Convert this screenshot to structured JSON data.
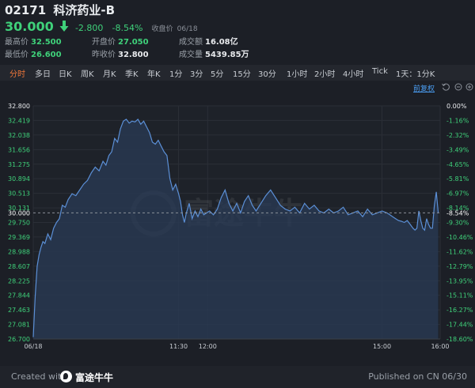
{
  "stock": {
    "code": "02171",
    "name": "科济药业-B",
    "price": "30.000",
    "change": "-2.800",
    "change_pct": "-8.54%",
    "closed_label": "收盘价",
    "date": "06/18"
  },
  "stats": {
    "high_label": "最高价",
    "high": "32.500",
    "low_label": "最低价",
    "low": "26.600",
    "open_label": "开盘价",
    "open": "27.050",
    "prev_label": "昨收价",
    "prev": "32.800",
    "turnover_label": "成交额",
    "turnover": "16.08亿",
    "volume_label": "成交量",
    "volume": "5439.85万"
  },
  "tabs": [
    "分时",
    "多日",
    "日K",
    "周K",
    "月K",
    "季K",
    "年K",
    "1分",
    "3分",
    "5分",
    "15分",
    "30分",
    "1小时",
    "2小时",
    "4小时",
    "Tick",
    "1天：1分K"
  ],
  "active_tab": 0,
  "adjust_label": "前复权",
  "watermark": "富途牛牛",
  "footer": {
    "created_with": "Created with",
    "brand": "富途牛牛",
    "published": "Published on CN 06/30"
  },
  "colors": {
    "background": "#1c1f26",
    "line": "#5b8fd6",
    "area": "#2a3b55",
    "down": "#3fd17a",
    "active_tab": "#f0773a",
    "link": "#4a9cf0"
  },
  "chart_data": {
    "type": "area",
    "left_ticks": [
      "32.800",
      "32.419",
      "32.038",
      "31.656",
      "31.275",
      "30.894",
      "30.513",
      "30.131",
      "30.000",
      "29.750",
      "29.369",
      "28.988",
      "28.607",
      "28.225",
      "27.844",
      "27.463",
      "27.081",
      "26.700"
    ],
    "right_ticks": [
      "0.00%",
      "-1.16%",
      "-2.32%",
      "-3.49%",
      "-4.65%",
      "-5.81%",
      "-6.97%",
      "-8.14%",
      "-8.54%",
      "-9.30%",
      "-10.46%",
      "-11.62%",
      "-12.79%",
      "-13.95%",
      "-15.11%",
      "-16.27%",
      "-17.44%",
      "-18.60%"
    ],
    "x_labels": [
      "06/18",
      "11:30",
      "12:00",
      "15:00",
      "16:00"
    ],
    "x_label_minutes": [
      0,
      150,
      180,
      360,
      420
    ],
    "ylim": [
      26.7,
      32.8
    ],
    "xlim": [
      0,
      420
    ],
    "reference_price": 32.8,
    "last_price": 30.0,
    "x": [
      0,
      2,
      4,
      6,
      8,
      10,
      12,
      15,
      18,
      21,
      24,
      27,
      30,
      33,
      36,
      40,
      44,
      48,
      52,
      56,
      60,
      64,
      68,
      72,
      75,
      78,
      81,
      84,
      87,
      90,
      93,
      96,
      99,
      102,
      105,
      108,
      111,
      114,
      117,
      120,
      123,
      126,
      129,
      132,
      135,
      138,
      141,
      144,
      147,
      150,
      152,
      154,
      156,
      158,
      161,
      164,
      167,
      170,
      173,
      176,
      179,
      182,
      186,
      190,
      194,
      198,
      202,
      206,
      210,
      214,
      218,
      222,
      226,
      230,
      235,
      240,
      245,
      250,
      255,
      260,
      265,
      270,
      275,
      280,
      285,
      290,
      295,
      300,
      305,
      310,
      315,
      320,
      325,
      330,
      335,
      340,
      345,
      350,
      355,
      360,
      365,
      368,
      371,
      374,
      377,
      380,
      383,
      386,
      389,
      392,
      394,
      396,
      398,
      400,
      402,
      404,
      406,
      408,
      410,
      412,
      414,
      416,
      418
    ],
    "y": [
      26.75,
      27.8,
      28.6,
      28.9,
      29.1,
      29.25,
      29.2,
      29.45,
      29.3,
      29.6,
      29.75,
      29.85,
      30.2,
      30.15,
      30.35,
      30.5,
      30.45,
      30.6,
      30.75,
      30.85,
      31.05,
      31.2,
      31.1,
      31.35,
      31.25,
      31.5,
      31.6,
      31.95,
      31.85,
      32.2,
      32.4,
      32.45,
      32.35,
      32.4,
      32.38,
      32.45,
      32.32,
      32.4,
      32.25,
      32.1,
      31.85,
      31.8,
      31.9,
      31.75,
      31.6,
      31.5,
      30.9,
      30.6,
      30.75,
      30.5,
      30.3,
      29.95,
      29.75,
      30.0,
      30.25,
      29.85,
      30.05,
      29.9,
      30.1,
      29.95,
      30.0,
      30.05,
      29.95,
      30.1,
      30.4,
      30.6,
      30.25,
      30.05,
      30.25,
      30.0,
      30.3,
      30.45,
      30.2,
      30.05,
      30.25,
      30.45,
      30.6,
      30.4,
      30.2,
      30.1,
      30.05,
      30.15,
      30.0,
      30.25,
      30.1,
      30.2,
      30.05,
      30.0,
      30.1,
      30.0,
      30.05,
      30.15,
      29.95,
      30.0,
      30.05,
      29.9,
      30.1,
      29.95,
      30.0,
      30.05,
      30.0,
      29.95,
      29.9,
      29.85,
      29.8,
      29.78,
      29.75,
      29.8,
      29.7,
      29.6,
      29.55,
      29.6,
      30.05,
      29.8,
      29.6,
      29.55,
      29.85,
      29.7,
      29.6,
      29.6,
      30.2,
      30.55,
      30.0
    ]
  }
}
